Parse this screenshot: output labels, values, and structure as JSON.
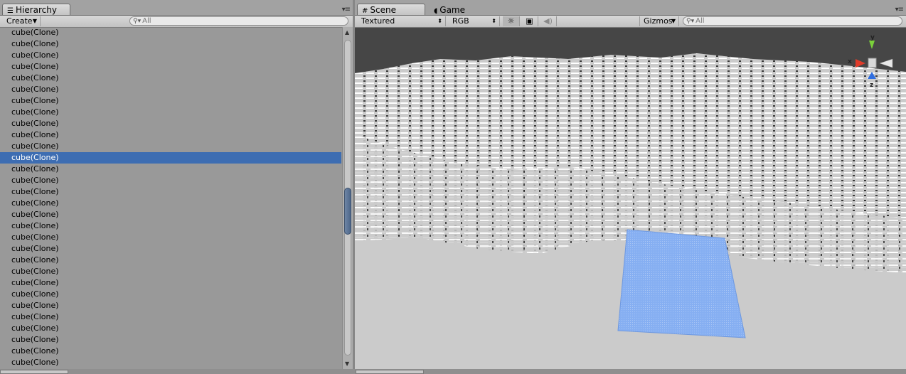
{
  "hierarchy": {
    "tab_label": "Hierarchy",
    "create_label": "Create",
    "search_placeholder": "All",
    "items": [
      {
        "label": "cube(Clone)"
      },
      {
        "label": "cube(Clone)"
      },
      {
        "label": "cube(Clone)"
      },
      {
        "label": "cube(Clone)"
      },
      {
        "label": "cube(Clone)"
      },
      {
        "label": "cube(Clone)"
      },
      {
        "label": "cube(Clone)"
      },
      {
        "label": "cube(Clone)"
      },
      {
        "label": "cube(Clone)"
      },
      {
        "label": "cube(Clone)"
      },
      {
        "label": "cube(Clone)"
      },
      {
        "label": "cube(Clone)",
        "selected": true
      },
      {
        "label": "cube(Clone)"
      },
      {
        "label": "cube(Clone)"
      },
      {
        "label": "cube(Clone)"
      },
      {
        "label": "cube(Clone)"
      },
      {
        "label": "cube(Clone)"
      },
      {
        "label": "cube(Clone)"
      },
      {
        "label": "cube(Clone)"
      },
      {
        "label": "cube(Clone)"
      },
      {
        "label": "cube(Clone)"
      },
      {
        "label": "cube(Clone)"
      },
      {
        "label": "cube(Clone)"
      },
      {
        "label": "cube(Clone)"
      },
      {
        "label": "cube(Clone)"
      },
      {
        "label": "cube(Clone)"
      },
      {
        "label": "cube(Clone)"
      },
      {
        "label": "cube(Clone)"
      },
      {
        "label": "cube(Clone)"
      },
      {
        "label": "cube(Clone)"
      }
    ]
  },
  "scene": {
    "tab_scene": "Scene",
    "tab_game": "Game",
    "render_mode": "Textured",
    "color_mode": "RGB",
    "gizmos_label": "Gizmos",
    "search_placeholder": "All",
    "gizmo_axes": {
      "x": "x",
      "y": "y",
      "z": "z"
    }
  },
  "colors": {
    "selection": "#3d6db2",
    "sky": "#464646",
    "terrain": "#cbcbcb",
    "plane": "#7aa7ef"
  },
  "icons": {
    "hierarchy_tab": "list-icon",
    "scene_tab": "grid-icon",
    "game_tab": "pacman-icon",
    "lighting": "sun-icon",
    "image": "image-icon",
    "audio": "speaker-icon"
  }
}
